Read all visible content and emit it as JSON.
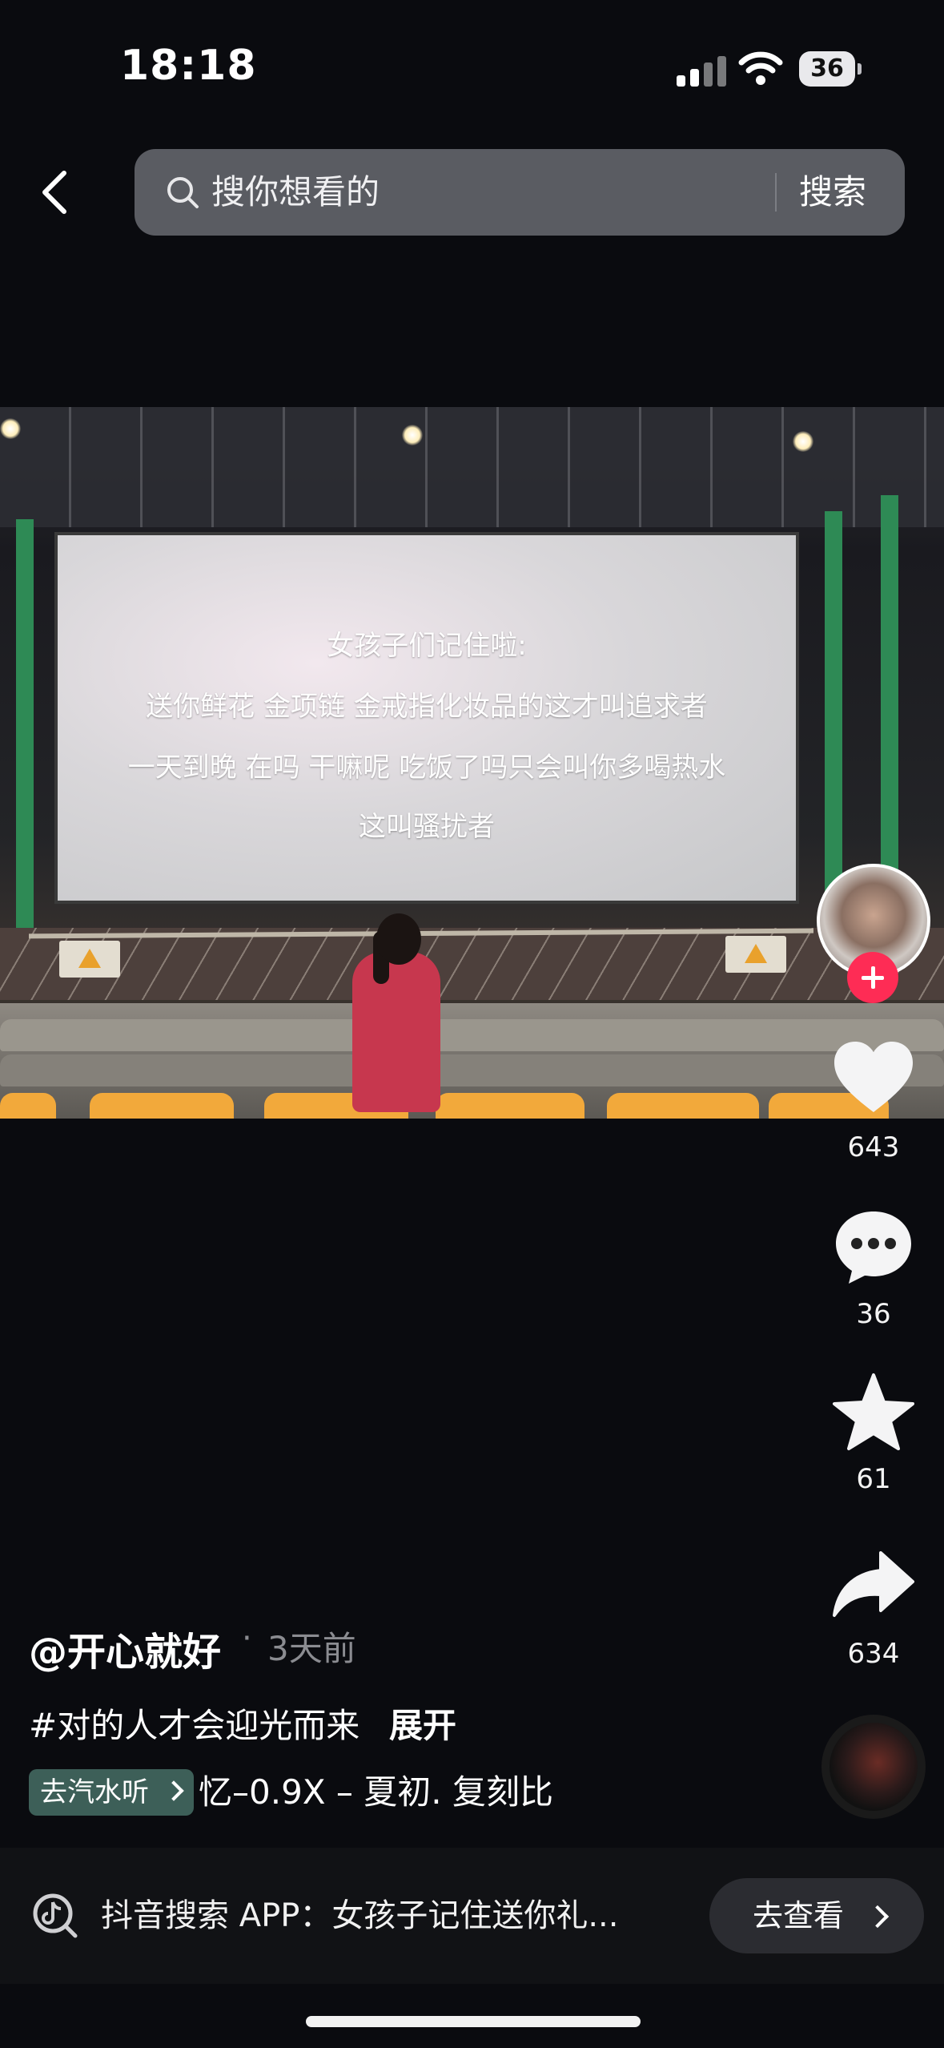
{
  "status_bar": {
    "time": "18:18",
    "battery": "36"
  },
  "search": {
    "placeholder": "搜你想看的",
    "button_label": "搜索"
  },
  "video": {
    "screen_text": [
      "女孩子们记住啦:",
      "送你鲜花 金项链 金戒指化妆品的这才叫追求者",
      "一天到晚 在吗 干嘛呢 吃饭了吗只会叫你多喝热水",
      "这叫骚扰者"
    ]
  },
  "side_actions": {
    "likes": "643",
    "comments": "36",
    "favorites": "61",
    "shares": "634"
  },
  "post": {
    "author": "@开心就好",
    "separator": "·",
    "time_ago": "3天前",
    "hashtag": "#对的人才会迎光而来",
    "expand_label": "展开",
    "music_chip": "去汽水听",
    "music_text": "忆–0.9X – 夏初.    复刻比"
  },
  "bottom_bar": {
    "text": "抖音搜索 APP：女孩子记住送你礼...",
    "button_label": "去查看"
  },
  "colors": {
    "follow": "#fe2c55",
    "music_chip": "#3d5f58",
    "background": "#0a0b0f"
  }
}
